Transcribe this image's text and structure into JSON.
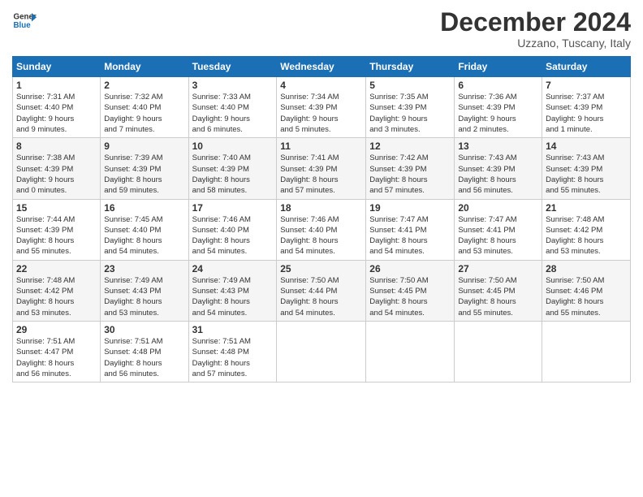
{
  "header": {
    "logo_line1": "General",
    "logo_line2": "Blue",
    "month": "December 2024",
    "location": "Uzzano, Tuscany, Italy"
  },
  "days_of_week": [
    "Sunday",
    "Monday",
    "Tuesday",
    "Wednesday",
    "Thursday",
    "Friday",
    "Saturday"
  ],
  "weeks": [
    [
      {
        "day": "1",
        "info": "Sunrise: 7:31 AM\nSunset: 4:40 PM\nDaylight: 9 hours\nand 9 minutes."
      },
      {
        "day": "2",
        "info": "Sunrise: 7:32 AM\nSunset: 4:40 PM\nDaylight: 9 hours\nand 7 minutes."
      },
      {
        "day": "3",
        "info": "Sunrise: 7:33 AM\nSunset: 4:40 PM\nDaylight: 9 hours\nand 6 minutes."
      },
      {
        "day": "4",
        "info": "Sunrise: 7:34 AM\nSunset: 4:39 PM\nDaylight: 9 hours\nand 5 minutes."
      },
      {
        "day": "5",
        "info": "Sunrise: 7:35 AM\nSunset: 4:39 PM\nDaylight: 9 hours\nand 3 minutes."
      },
      {
        "day": "6",
        "info": "Sunrise: 7:36 AM\nSunset: 4:39 PM\nDaylight: 9 hours\nand 2 minutes."
      },
      {
        "day": "7",
        "info": "Sunrise: 7:37 AM\nSunset: 4:39 PM\nDaylight: 9 hours\nand 1 minute."
      }
    ],
    [
      {
        "day": "8",
        "info": "Sunrise: 7:38 AM\nSunset: 4:39 PM\nDaylight: 9 hours\nand 0 minutes."
      },
      {
        "day": "9",
        "info": "Sunrise: 7:39 AM\nSunset: 4:39 PM\nDaylight: 8 hours\nand 59 minutes."
      },
      {
        "day": "10",
        "info": "Sunrise: 7:40 AM\nSunset: 4:39 PM\nDaylight: 8 hours\nand 58 minutes."
      },
      {
        "day": "11",
        "info": "Sunrise: 7:41 AM\nSunset: 4:39 PM\nDaylight: 8 hours\nand 57 minutes."
      },
      {
        "day": "12",
        "info": "Sunrise: 7:42 AM\nSunset: 4:39 PM\nDaylight: 8 hours\nand 57 minutes."
      },
      {
        "day": "13",
        "info": "Sunrise: 7:43 AM\nSunset: 4:39 PM\nDaylight: 8 hours\nand 56 minutes."
      },
      {
        "day": "14",
        "info": "Sunrise: 7:43 AM\nSunset: 4:39 PM\nDaylight: 8 hours\nand 55 minutes."
      }
    ],
    [
      {
        "day": "15",
        "info": "Sunrise: 7:44 AM\nSunset: 4:39 PM\nDaylight: 8 hours\nand 55 minutes."
      },
      {
        "day": "16",
        "info": "Sunrise: 7:45 AM\nSunset: 4:40 PM\nDaylight: 8 hours\nand 54 minutes."
      },
      {
        "day": "17",
        "info": "Sunrise: 7:46 AM\nSunset: 4:40 PM\nDaylight: 8 hours\nand 54 minutes."
      },
      {
        "day": "18",
        "info": "Sunrise: 7:46 AM\nSunset: 4:40 PM\nDaylight: 8 hours\nand 54 minutes."
      },
      {
        "day": "19",
        "info": "Sunrise: 7:47 AM\nSunset: 4:41 PM\nDaylight: 8 hours\nand 54 minutes."
      },
      {
        "day": "20",
        "info": "Sunrise: 7:47 AM\nSunset: 4:41 PM\nDaylight: 8 hours\nand 53 minutes."
      },
      {
        "day": "21",
        "info": "Sunrise: 7:48 AM\nSunset: 4:42 PM\nDaylight: 8 hours\nand 53 minutes."
      }
    ],
    [
      {
        "day": "22",
        "info": "Sunrise: 7:48 AM\nSunset: 4:42 PM\nDaylight: 8 hours\nand 53 minutes."
      },
      {
        "day": "23",
        "info": "Sunrise: 7:49 AM\nSunset: 4:43 PM\nDaylight: 8 hours\nand 53 minutes."
      },
      {
        "day": "24",
        "info": "Sunrise: 7:49 AM\nSunset: 4:43 PM\nDaylight: 8 hours\nand 54 minutes."
      },
      {
        "day": "25",
        "info": "Sunrise: 7:50 AM\nSunset: 4:44 PM\nDaylight: 8 hours\nand 54 minutes."
      },
      {
        "day": "26",
        "info": "Sunrise: 7:50 AM\nSunset: 4:45 PM\nDaylight: 8 hours\nand 54 minutes."
      },
      {
        "day": "27",
        "info": "Sunrise: 7:50 AM\nSunset: 4:45 PM\nDaylight: 8 hours\nand 55 minutes."
      },
      {
        "day": "28",
        "info": "Sunrise: 7:50 AM\nSunset: 4:46 PM\nDaylight: 8 hours\nand 55 minutes."
      }
    ],
    [
      {
        "day": "29",
        "info": "Sunrise: 7:51 AM\nSunset: 4:47 PM\nDaylight: 8 hours\nand 56 minutes."
      },
      {
        "day": "30",
        "info": "Sunrise: 7:51 AM\nSunset: 4:48 PM\nDaylight: 8 hours\nand 56 minutes."
      },
      {
        "day": "31",
        "info": "Sunrise: 7:51 AM\nSunset: 4:48 PM\nDaylight: 8 hours\nand 57 minutes."
      },
      {
        "day": "",
        "info": ""
      },
      {
        "day": "",
        "info": ""
      },
      {
        "day": "",
        "info": ""
      },
      {
        "day": "",
        "info": ""
      }
    ]
  ]
}
